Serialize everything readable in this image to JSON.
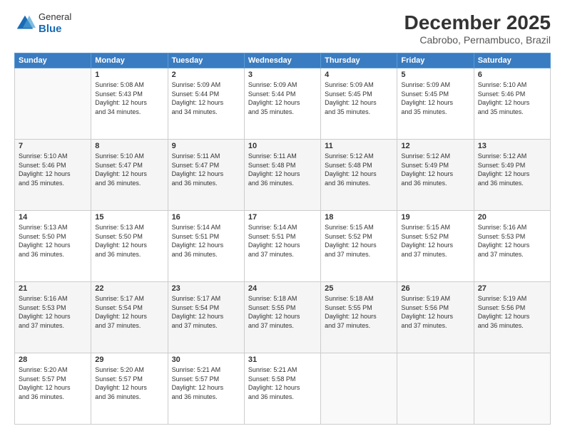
{
  "header": {
    "logo": {
      "general": "General",
      "blue": "Blue"
    },
    "title": "December 2025",
    "subtitle": "Cabrobo, Pernambuco, Brazil"
  },
  "calendar": {
    "weekdays": [
      "Sunday",
      "Monday",
      "Tuesday",
      "Wednesday",
      "Thursday",
      "Friday",
      "Saturday"
    ],
    "weeks": [
      [
        {
          "day": "",
          "info": ""
        },
        {
          "day": "1",
          "info": "Sunrise: 5:08 AM\nSunset: 5:43 PM\nDaylight: 12 hours\nand 34 minutes."
        },
        {
          "day": "2",
          "info": "Sunrise: 5:09 AM\nSunset: 5:44 PM\nDaylight: 12 hours\nand 34 minutes."
        },
        {
          "day": "3",
          "info": "Sunrise: 5:09 AM\nSunset: 5:44 PM\nDaylight: 12 hours\nand 35 minutes."
        },
        {
          "day": "4",
          "info": "Sunrise: 5:09 AM\nSunset: 5:45 PM\nDaylight: 12 hours\nand 35 minutes."
        },
        {
          "day": "5",
          "info": "Sunrise: 5:09 AM\nSunset: 5:45 PM\nDaylight: 12 hours\nand 35 minutes."
        },
        {
          "day": "6",
          "info": "Sunrise: 5:10 AM\nSunset: 5:46 PM\nDaylight: 12 hours\nand 35 minutes."
        }
      ],
      [
        {
          "day": "7",
          "info": "Sunrise: 5:10 AM\nSunset: 5:46 PM\nDaylight: 12 hours\nand 35 minutes."
        },
        {
          "day": "8",
          "info": "Sunrise: 5:10 AM\nSunset: 5:47 PM\nDaylight: 12 hours\nand 36 minutes."
        },
        {
          "day": "9",
          "info": "Sunrise: 5:11 AM\nSunset: 5:47 PM\nDaylight: 12 hours\nand 36 minutes."
        },
        {
          "day": "10",
          "info": "Sunrise: 5:11 AM\nSunset: 5:48 PM\nDaylight: 12 hours\nand 36 minutes."
        },
        {
          "day": "11",
          "info": "Sunrise: 5:12 AM\nSunset: 5:48 PM\nDaylight: 12 hours\nand 36 minutes."
        },
        {
          "day": "12",
          "info": "Sunrise: 5:12 AM\nSunset: 5:49 PM\nDaylight: 12 hours\nand 36 minutes."
        },
        {
          "day": "13",
          "info": "Sunrise: 5:12 AM\nSunset: 5:49 PM\nDaylight: 12 hours\nand 36 minutes."
        }
      ],
      [
        {
          "day": "14",
          "info": "Sunrise: 5:13 AM\nSunset: 5:50 PM\nDaylight: 12 hours\nand 36 minutes."
        },
        {
          "day": "15",
          "info": "Sunrise: 5:13 AM\nSunset: 5:50 PM\nDaylight: 12 hours\nand 36 minutes."
        },
        {
          "day": "16",
          "info": "Sunrise: 5:14 AM\nSunset: 5:51 PM\nDaylight: 12 hours\nand 36 minutes."
        },
        {
          "day": "17",
          "info": "Sunrise: 5:14 AM\nSunset: 5:51 PM\nDaylight: 12 hours\nand 37 minutes."
        },
        {
          "day": "18",
          "info": "Sunrise: 5:15 AM\nSunset: 5:52 PM\nDaylight: 12 hours\nand 37 minutes."
        },
        {
          "day": "19",
          "info": "Sunrise: 5:15 AM\nSunset: 5:52 PM\nDaylight: 12 hours\nand 37 minutes."
        },
        {
          "day": "20",
          "info": "Sunrise: 5:16 AM\nSunset: 5:53 PM\nDaylight: 12 hours\nand 37 minutes."
        }
      ],
      [
        {
          "day": "21",
          "info": "Sunrise: 5:16 AM\nSunset: 5:53 PM\nDaylight: 12 hours\nand 37 minutes."
        },
        {
          "day": "22",
          "info": "Sunrise: 5:17 AM\nSunset: 5:54 PM\nDaylight: 12 hours\nand 37 minutes."
        },
        {
          "day": "23",
          "info": "Sunrise: 5:17 AM\nSunset: 5:54 PM\nDaylight: 12 hours\nand 37 minutes."
        },
        {
          "day": "24",
          "info": "Sunrise: 5:18 AM\nSunset: 5:55 PM\nDaylight: 12 hours\nand 37 minutes."
        },
        {
          "day": "25",
          "info": "Sunrise: 5:18 AM\nSunset: 5:55 PM\nDaylight: 12 hours\nand 37 minutes."
        },
        {
          "day": "26",
          "info": "Sunrise: 5:19 AM\nSunset: 5:56 PM\nDaylight: 12 hours\nand 37 minutes."
        },
        {
          "day": "27",
          "info": "Sunrise: 5:19 AM\nSunset: 5:56 PM\nDaylight: 12 hours\nand 36 minutes."
        }
      ],
      [
        {
          "day": "28",
          "info": "Sunrise: 5:20 AM\nSunset: 5:57 PM\nDaylight: 12 hours\nand 36 minutes."
        },
        {
          "day": "29",
          "info": "Sunrise: 5:20 AM\nSunset: 5:57 PM\nDaylight: 12 hours\nand 36 minutes."
        },
        {
          "day": "30",
          "info": "Sunrise: 5:21 AM\nSunset: 5:57 PM\nDaylight: 12 hours\nand 36 minutes."
        },
        {
          "day": "31",
          "info": "Sunrise: 5:21 AM\nSunset: 5:58 PM\nDaylight: 12 hours\nand 36 minutes."
        },
        {
          "day": "",
          "info": ""
        },
        {
          "day": "",
          "info": ""
        },
        {
          "day": "",
          "info": ""
        }
      ]
    ]
  }
}
